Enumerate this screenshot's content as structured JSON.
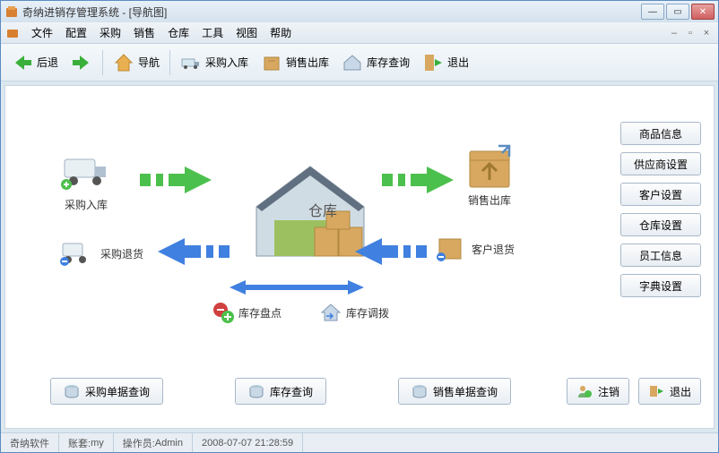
{
  "window": {
    "title": "奇纳进销存管理系统 - [导航图]"
  },
  "menu": {
    "items": [
      "文件",
      "配置",
      "采购",
      "销售",
      "仓库",
      "工具",
      "视图",
      "帮助"
    ]
  },
  "toolbar": {
    "back": "后退",
    "nav": "导航",
    "purchase_in": "采购入库",
    "sale_out": "销售出库",
    "stock_query": "库存查询",
    "exit": "退出"
  },
  "sidebar": {
    "items": [
      "商品信息",
      "供应商设置",
      "客户设置",
      "仓库设置",
      "员工信息",
      "字典设置"
    ]
  },
  "diagram": {
    "purchase_in": "采购入库",
    "purchase_return": "采购退货",
    "warehouse": "仓库",
    "sale_out": "销售出库",
    "customer_return": "客户退货",
    "stock_check": "库存盘点",
    "stock_transfer": "库存调拨"
  },
  "bottom": {
    "purchase_query": "采购单据查询",
    "stock_query": "库存查询",
    "sale_query": "销售单据查询",
    "logout": "注销",
    "exit": "退出"
  },
  "status": {
    "company": "奇纳软件",
    "account_label": "账套:",
    "account_value": "my",
    "operator_label": "操作员:",
    "operator_value": "Admin",
    "datetime": "2008-07-07 21:28:59"
  }
}
